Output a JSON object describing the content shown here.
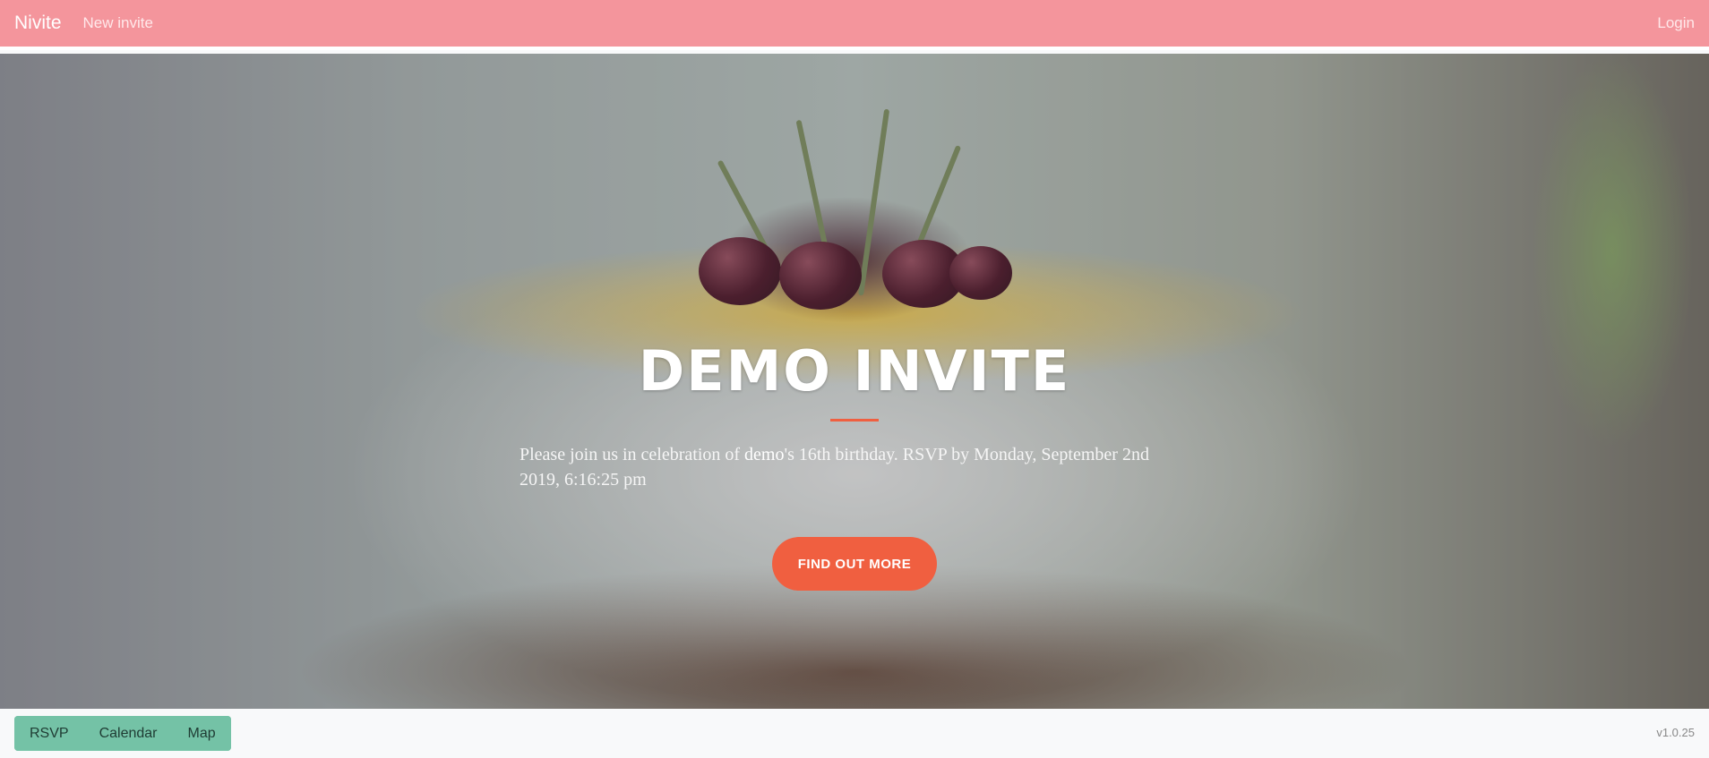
{
  "navbar": {
    "brand": "Nivite",
    "new_invite": "New invite",
    "login": "Login",
    "color": "#f4959c"
  },
  "hero": {
    "title": "DEMO INVITE",
    "text_before": "Please join us in celebration of ",
    "name": "demo",
    "text_after": "'s 16th birthday. RSVP by Monday, September 2nd 2019, 6:16:25 pm",
    "cta_label": "FIND OUT MORE",
    "accent_color": "#f05f40",
    "background_icon": "birthday-cake-photo"
  },
  "footer": {
    "buttons": [
      "RSVP",
      "Calendar",
      "Map"
    ],
    "button_color": "#74c2a6",
    "version": "v1.0.25"
  }
}
